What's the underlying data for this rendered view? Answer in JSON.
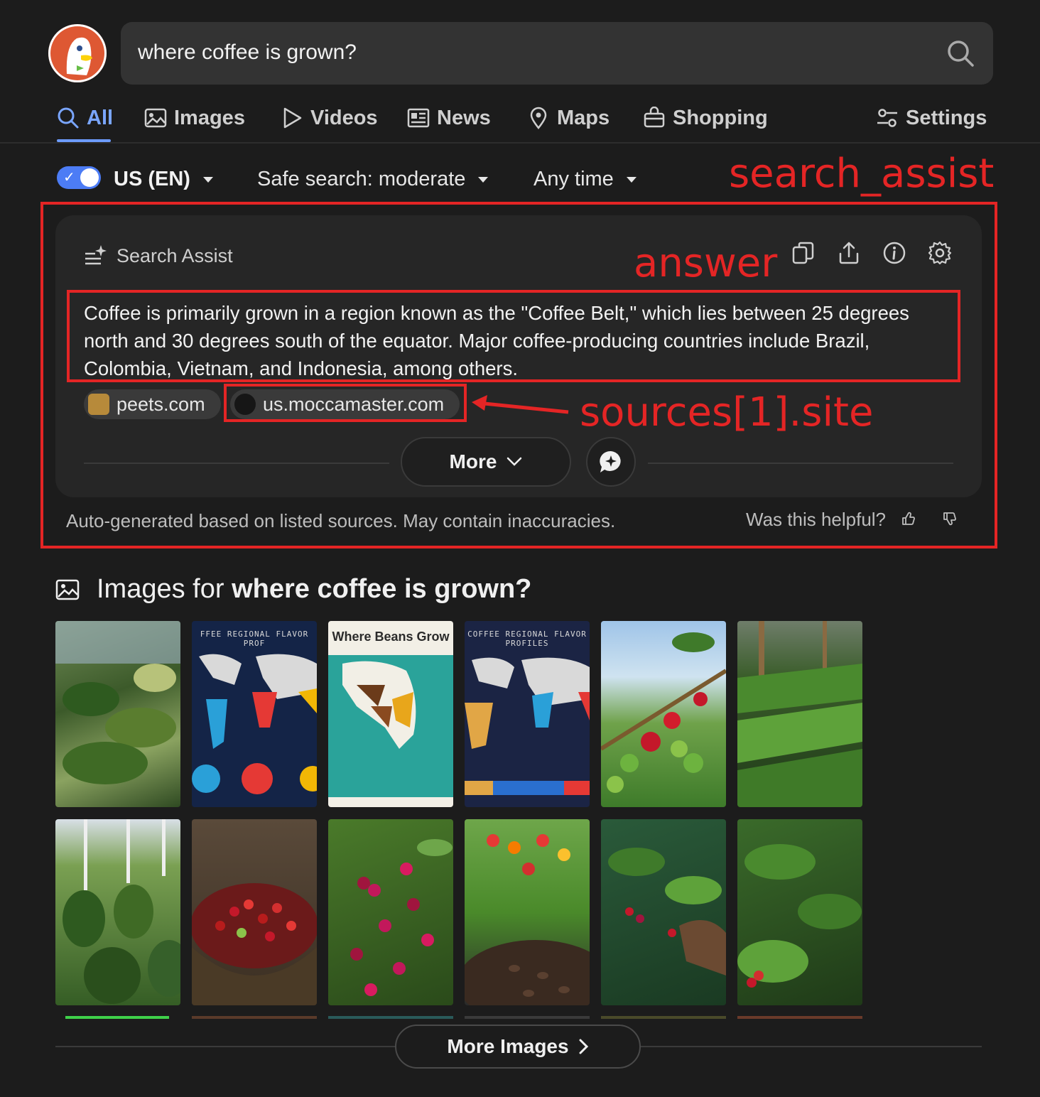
{
  "search": {
    "query": "where coffee is grown?"
  },
  "tabs": [
    {
      "label": "All",
      "icon": "search-icon",
      "active": true
    },
    {
      "label": "Images",
      "icon": "image-icon"
    },
    {
      "label": "Videos",
      "icon": "play-icon"
    },
    {
      "label": "News",
      "icon": "newspaper-icon"
    },
    {
      "label": "Maps",
      "icon": "map-pin-icon"
    },
    {
      "label": "Shopping",
      "icon": "shopping-bag-icon"
    },
    {
      "label": "Settings",
      "icon": "sliders-icon"
    }
  ],
  "filters": {
    "region": "US (EN)",
    "region_toggle_on": true,
    "safe_search": "Safe search: moderate",
    "time": "Any time"
  },
  "annotations": {
    "search_assist": "search_assist",
    "answer": "answer",
    "sources_site": "sources[1].site"
  },
  "search_assist": {
    "title": "Search Assist",
    "answer": "Coffee is primarily grown in a region known as the \"Coffee Belt,\" which lies between 25 degrees north and 30 degrees south of the equator. Major coffee-producing countries include Brazil, Colombia, Vietnam, and Indonesia, among others.",
    "sources": [
      {
        "site": "peets.com"
      },
      {
        "site": "us.moccamaster.com"
      }
    ],
    "more_label": "More",
    "disclaimer": "Auto-generated based on listed sources. May contain inaccuracies.",
    "helpful_prompt": "Was this helpful?"
  },
  "images": {
    "heading_prefix": "Images for ",
    "heading_query": "where coffee is grown?",
    "thumb_captions": {
      "map1": "FFEE REGIONAL FLAVOR PROF",
      "map2": "Where Beans Grow",
      "map3": "COFFEE REGIONAL FLAVOR PROFILES"
    },
    "more_label": "More Images"
  },
  "colors": {
    "accent": "#6d9cff",
    "annotation_red": "#e42525",
    "background": "#1c1c1c"
  }
}
